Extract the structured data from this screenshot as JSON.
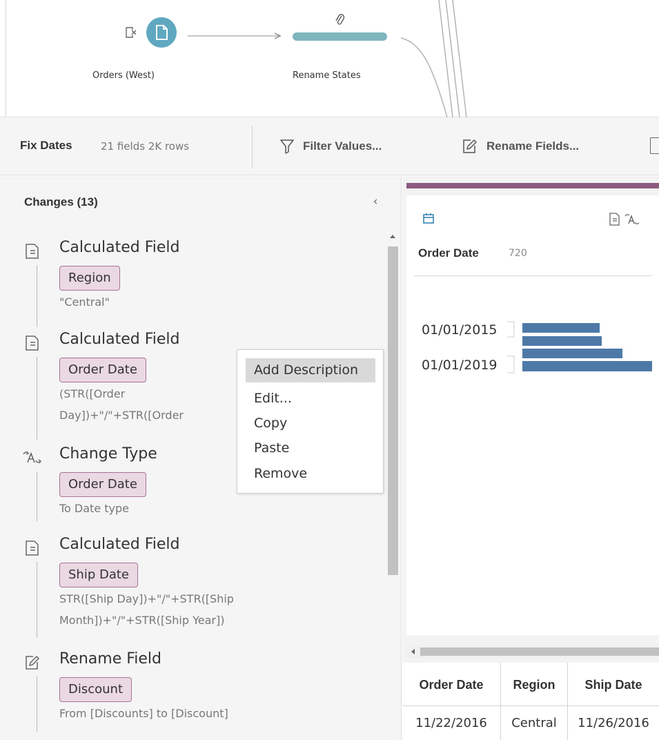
{
  "flow": {
    "nodes": [
      {
        "label": "Orders (West)",
        "type": "input",
        "color": "#5fa8c0",
        "icon": "file-icon"
      },
      {
        "label": "Rename States",
        "type": "clean",
        "color": "#7fb5bd",
        "icon": "paperclip-icon"
      }
    ]
  },
  "toolbar": {
    "step_name": "Fix Dates",
    "step_meta": "21 fields  2K rows",
    "buttons": [
      {
        "label": "Filter Values...",
        "icon": "filter-icon"
      },
      {
        "label": "Rename Fields...",
        "icon": "rename-icon"
      }
    ]
  },
  "changes": {
    "title": "Changes (13)",
    "collapse_icon": "chevron-left-icon",
    "items": [
      {
        "type": "Calculated Field",
        "icon": "calculated-field-icon",
        "field": "Region",
        "desc_lines": [
          "\"Central\""
        ]
      },
      {
        "type": "Calculated Field",
        "icon": "calculated-field-icon",
        "field": "Order Date",
        "desc_lines": [
          "(STR([Order",
          "Day])+\"/\"+STR([Order"
        ]
      },
      {
        "type": "Change Type",
        "icon": "change-type-icon",
        "field": "Order Date",
        "desc_lines": [
          "To Date type"
        ]
      },
      {
        "type": "Calculated Field",
        "icon": "calculated-field-icon",
        "field": "Ship Date",
        "desc_lines": [
          "STR([Ship Day])+\"/\"+STR([Ship",
          "Month])+\"/\"+STR([Ship Year])"
        ]
      },
      {
        "type": "Rename Field",
        "icon": "rename-icon",
        "field": "Discount",
        "desc_lines": [
          "From [Discounts] to [Discount]"
        ]
      }
    ]
  },
  "context_menu": {
    "items": [
      "Add Description",
      "Edit...",
      "Copy",
      "Paste",
      "Remove"
    ],
    "highlighted": "Add Description"
  },
  "profile": {
    "accent_color": "#8d5a80",
    "field_icon": "calendar-icon",
    "field_name": "Order Date",
    "field_count": "720",
    "chart_data": {
      "type": "bar",
      "orientation": "horizontal",
      "tick_labels": [
        "01/01/2015",
        "01/01/2019"
      ],
      "color": "#4e79a7"
    }
  },
  "grid": {
    "columns": [
      "Order Date",
      "Region",
      "Ship Date"
    ],
    "rows": [
      [
        "11/22/2016",
        "Central",
        "11/26/2016"
      ]
    ]
  }
}
